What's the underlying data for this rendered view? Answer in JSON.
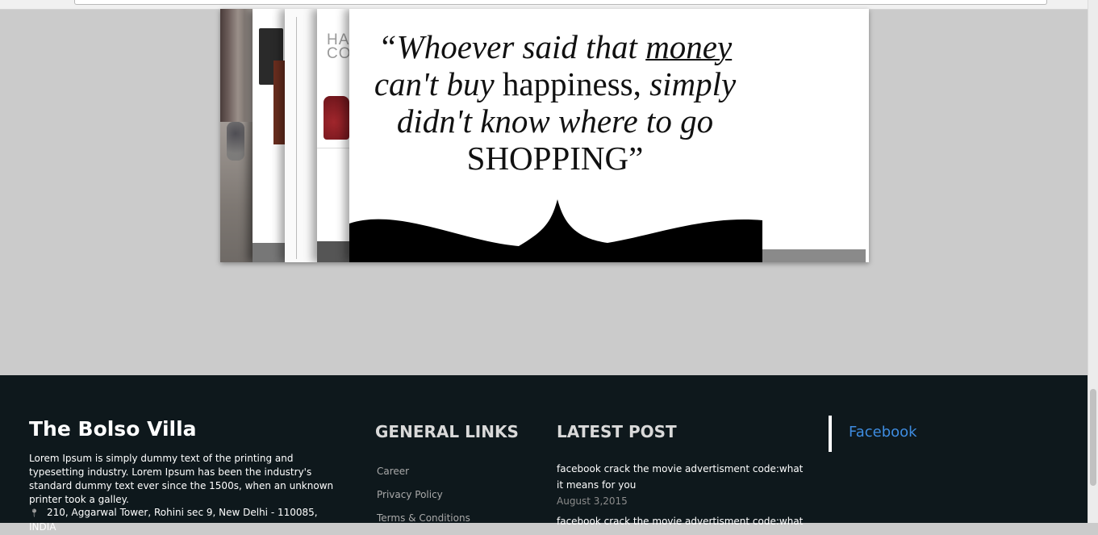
{
  "slider": {
    "partial_heading": "HA\nCO",
    "quote": {
      "w1": "“Whoever said that ",
      "w2": "money",
      "w3": "can't buy",
      "w4": " happiness, ",
      "w5": "simply",
      "w6": "didn't know where to go",
      "w7": "SHOPPING”"
    }
  },
  "footer": {
    "brand": "The Bolso Villa",
    "about": "Lorem Ipsum is simply dummy text of the printing and typesetting industry. Lorem Ipsum has been the industry's standard dummy text ever since the 1500s, when an unknown printer took a galley.",
    "address": "210, Aggarwal Tower, Rohini sec 9, New Delhi -        110085, INDIA",
    "general_links": {
      "title": "GENERAL LINKS",
      "items": [
        "Career",
        "Privacy Policy",
        "Terms & Conditions"
      ]
    },
    "latest_post": {
      "title": "LATEST POST",
      "posts": [
        {
          "title": "facebook crack the movie advertisment code:what it means for you",
          "date": "August 3,2015"
        },
        {
          "title": "facebook crack the movie advertisment code:what it"
        }
      ]
    },
    "social": {
      "facebook": "Facebook"
    }
  },
  "colors": {
    "page_bg": "#cbcbcb",
    "footer_bg": "#0e181c",
    "link_blue": "#3e8ce0"
  }
}
